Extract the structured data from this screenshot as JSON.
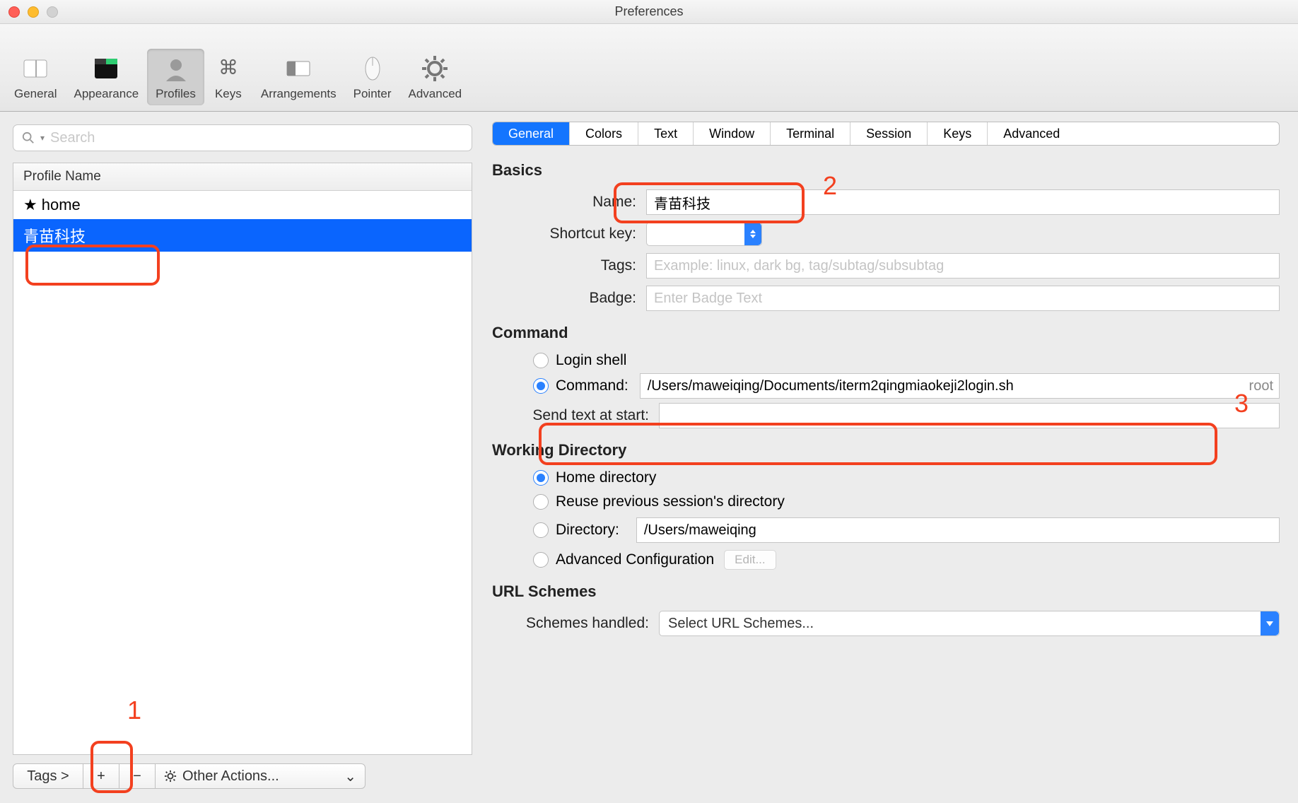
{
  "window": {
    "title": "Preferences"
  },
  "toolbar": {
    "items": [
      {
        "label": "General"
      },
      {
        "label": "Appearance"
      },
      {
        "label": "Profiles"
      },
      {
        "label": "Keys"
      },
      {
        "label": "Arrangements"
      },
      {
        "label": "Pointer"
      },
      {
        "label": "Advanced"
      }
    ],
    "active_index": 2
  },
  "left": {
    "search_placeholder": "Search",
    "header": "Profile Name",
    "profiles": [
      {
        "name": "home",
        "starred": true,
        "selected": false
      },
      {
        "name": "青苗科技",
        "starred": false,
        "selected": true
      }
    ],
    "footer": {
      "tags_label": "Tags >",
      "other_actions_label": "Other Actions..."
    }
  },
  "tabs": {
    "items": [
      "General",
      "Colors",
      "Text",
      "Window",
      "Terminal",
      "Session",
      "Keys",
      "Advanced"
    ],
    "active_index": 0
  },
  "basics": {
    "section": "Basics",
    "name_label": "Name:",
    "name_value": "青苗科技",
    "shortcut_label": "Shortcut key:",
    "tags_label": "Tags:",
    "tags_placeholder": "Example: linux, dark bg, tag/subtag/subsubtag",
    "badge_label": "Badge:",
    "badge_placeholder": "Enter Badge Text"
  },
  "command": {
    "section": "Command",
    "login_shell_label": "Login shell",
    "command_label": "Command:",
    "command_value": "/Users/maweiqing/Documents/iterm2qingmiaokeji2login.sh",
    "command_suffix": "root",
    "send_text_label": "Send text at start:",
    "send_text_value": ""
  },
  "working_dir": {
    "section": "Working Directory",
    "home_label": "Home directory",
    "reuse_label": "Reuse previous session's directory",
    "dir_label": "Directory:",
    "dir_value": "/Users/maweiqing",
    "advanced_label": "Advanced Configuration",
    "edit_label": "Edit..."
  },
  "url_schemes": {
    "section": "URL Schemes",
    "handled_label": "Schemes handled:",
    "select_label": "Select URL Schemes..."
  },
  "annotations": {
    "n1": "1",
    "n2": "2",
    "n3": "3"
  }
}
